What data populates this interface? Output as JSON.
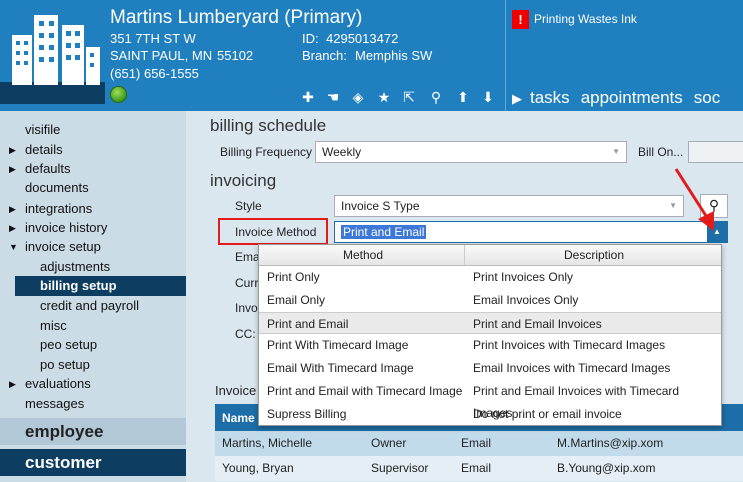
{
  "header": {
    "company": "Martins Lumberyard (Primary)",
    "address1": "351 7TH ST W",
    "address2": "SAINT PAUL, MN",
    "zip": "55102",
    "phone": "(651) 656-1555",
    "id_label": "ID:",
    "id_value": "4295013472",
    "branch_label": "Branch:",
    "branch_value": "Memphis SW",
    "alert": "Printing Wastes Ink",
    "tabs": [
      "tasks",
      "appointments",
      "soc"
    ]
  },
  "sidebar": {
    "items": [
      {
        "label": "visifile",
        "arrow": ""
      },
      {
        "label": "details",
        "arrow": "▶"
      },
      {
        "label": "defaults",
        "arrow": "▶"
      },
      {
        "label": "documents",
        "arrow": ""
      },
      {
        "label": "integrations",
        "arrow": "▶"
      },
      {
        "label": "invoice history",
        "arrow": "▶"
      },
      {
        "label": "invoice setup",
        "arrow": "▼"
      }
    ],
    "subitems": [
      "adjustments",
      "billing setup",
      "credit and payroll",
      "misc",
      "peo setup",
      "po setup"
    ],
    "after": [
      {
        "label": "evaluations",
        "arrow": "▶"
      },
      {
        "label": "messages",
        "arrow": ""
      }
    ],
    "employee": "employee",
    "customer": "customer"
  },
  "main": {
    "billing_schedule": "billing schedule",
    "billing_frequency_label": "Billing Frequency",
    "billing_frequency_value": "Weekly",
    "bill_on_label": "Bill On...",
    "invoicing": "invoicing",
    "style_label": "Style",
    "style_value": "Invoice S Type",
    "invoice_method_label": "Invoice Method",
    "invoice_method_value": "Print and Email",
    "partial_labels": [
      "Ema",
      "Curr",
      "Invo",
      "CC:"
    ],
    "invoice_partial": "Invoice"
  },
  "popup": {
    "col_method": "Method",
    "col_description": "Description",
    "rows": [
      {
        "method": "Print Only",
        "description": "Print Invoices Only"
      },
      {
        "method": "Email Only",
        "description": "Email Invoices Only"
      },
      {
        "method": "Print and Email",
        "description": "Print and Email Invoices"
      },
      {
        "method": "Print With Timecard Image",
        "description": "Print Invoices with Timecard Images"
      },
      {
        "method": "Email With Timecard Image",
        "description": "Email Invoices with Timecard Images"
      },
      {
        "method": "Print and Email with Timecard Image",
        "description": "Print and Email Invoices with Timecard Images"
      },
      {
        "method": "Supress Billing",
        "description": "Do not print or email invoice"
      }
    ]
  },
  "grid": {
    "col_name": "Name",
    "rows": [
      {
        "name": "Martins, Michelle",
        "role": "Owner",
        "method": "Email",
        "email": "M.Martins@xip.xom"
      },
      {
        "name": "Young, Bryan",
        "role": "Supervisor",
        "method": "Email",
        "email": "B.Young@xip.xom"
      }
    ]
  }
}
